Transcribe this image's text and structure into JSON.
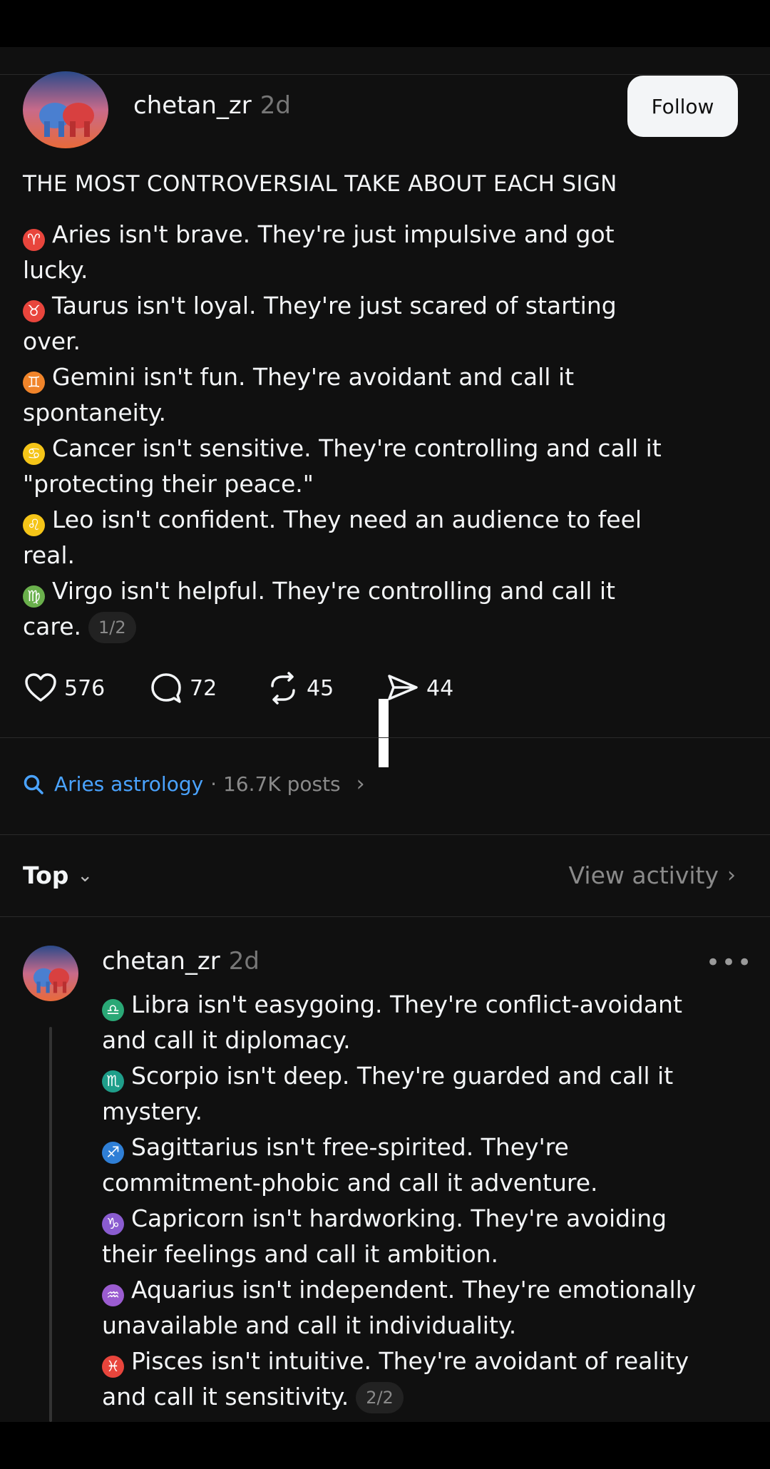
{
  "post": {
    "username": "chetan_zr",
    "time": "2d",
    "follow_label": "Follow",
    "title": "THE MOST CONTROVERSIAL TAKE ABOUT EACH SIGN",
    "lines": [
      {
        "icon": "aries-icon",
        "glyph": "♈",
        "color": "#e8453c",
        "text": "Aries isn't brave. They're just impulsive and got",
        "cont": "lucky."
      },
      {
        "icon": "taurus-icon",
        "glyph": "♉",
        "color": "#e8453c",
        "text": "Taurus isn't loyal. They're just scared of starting",
        "cont": "over."
      },
      {
        "icon": "gemini-icon",
        "glyph": "♊",
        "color": "#f0842a",
        "text": "Gemini isn't fun. They're avoidant and call it",
        "cont": "spontaneity."
      },
      {
        "icon": "cancer-icon",
        "glyph": "♋",
        "color": "#f5c518",
        "text": "Cancer isn't sensitive. They're controlling and call it",
        "cont": "\"protecting their peace.\""
      },
      {
        "icon": "leo-icon",
        "glyph": "♌",
        "color": "#f5c518",
        "text": "Leo isn't confident. They need an audience to feel",
        "cont": "real."
      },
      {
        "icon": "virgo-icon",
        "glyph": "♍",
        "color": "#6ab04c",
        "text": "Virgo isn't helpful. They're controlling and call it",
        "cont": "care."
      }
    ],
    "page_indicator": "1/2",
    "actions": {
      "likes": "576",
      "replies": "72",
      "reposts": "45",
      "shares": "44"
    }
  },
  "topic": {
    "name": "Aries astrology",
    "meta": "· 16.7K posts",
    "chevron": "›"
  },
  "sort": {
    "label": "Top",
    "chevron": "⌄",
    "view_activity": "View activity",
    "view_chevron": "›"
  },
  "reply": {
    "username": "chetan_zr",
    "time": "2d",
    "more": "•••",
    "lines": [
      {
        "icon": "libra-icon",
        "glyph": "♎",
        "color": "#2aa876",
        "text": "Libra isn't easygoing. They're conflict-avoidant",
        "cont": "and call it diplomacy."
      },
      {
        "icon": "scorpio-icon",
        "glyph": "♏",
        "color": "#1f9e8a",
        "text": "Scorpio isn't deep. They're guarded and call it",
        "cont": "mystery."
      },
      {
        "icon": "sagittarius-icon",
        "glyph": "♐",
        "color": "#2f7fd6",
        "text": "Sagittarius isn't free-spirited. They're",
        "cont": "commitment-phobic and call it adventure."
      },
      {
        "icon": "capricorn-icon",
        "glyph": "♑",
        "color": "#8a5cd0",
        "text": "Capricorn isn't hardworking. They're avoiding",
        "cont": "their feelings and call it ambition."
      },
      {
        "icon": "aquarius-icon",
        "glyph": "♒",
        "color": "#9b5cd0",
        "text": "Aquarius isn't independent. They're emotionally",
        "cont": "unavailable and call it individuality."
      },
      {
        "icon": "pisces-icon",
        "glyph": "♓",
        "color": "#e8453c",
        "text": "Pisces isn't intuitive. They're avoidant of reality",
        "cont": "and call it sensitivity."
      }
    ],
    "page_indicator": "2/2"
  }
}
